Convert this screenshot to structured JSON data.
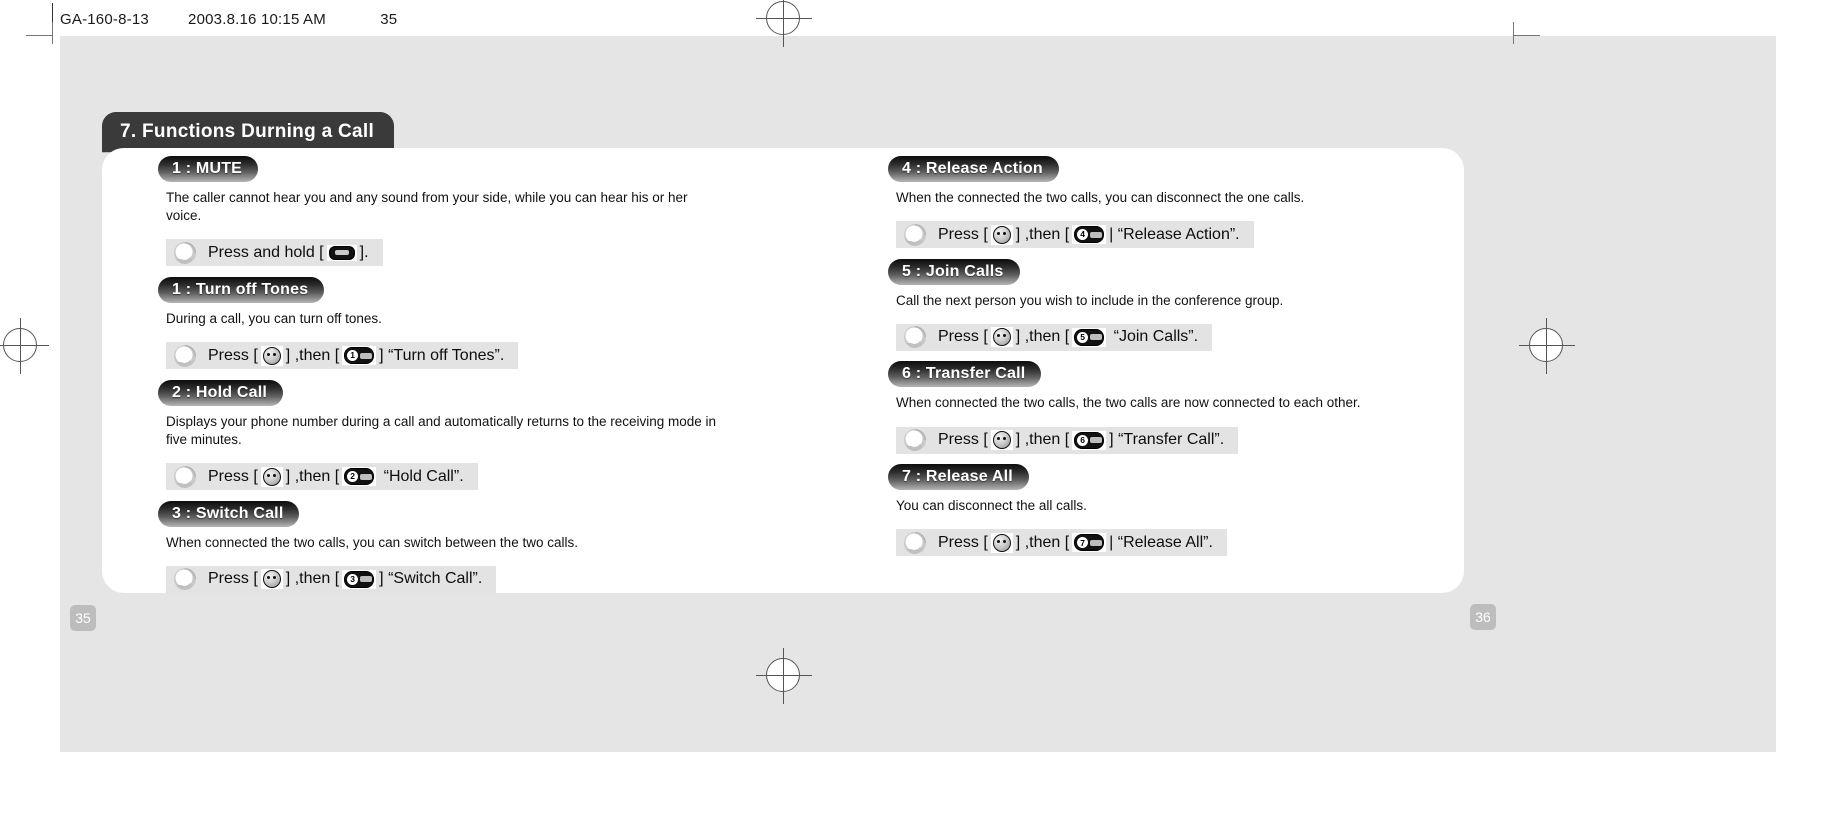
{
  "print_header": {
    "text": "GA-160-8-13　　  2003.8.16 10:15 AM 　　　 35"
  },
  "document": {
    "title": "7. Functions Durning a Call",
    "page_left": "35",
    "page_right": "36"
  },
  "icons": {
    "swirl": "swirl-bullet-icon",
    "menu_key": "menu-key-icon",
    "phone_key": "phone-key-icon"
  },
  "colors": {
    "title_bar": "#3a3a3a",
    "pill_dark": "#0d0d0d",
    "pill_light": "#b5b5b5",
    "instruction_band": "#e3e3e3",
    "page_number_bg": "#bdbdbd",
    "paper": "#e5e5e5"
  },
  "columns": {
    "left": [
      {
        "pill": "1 : MUTE",
        "desc": "The caller cannot hear you and any sound from your side, while you can hear his or her voice.",
        "instruction": {
          "prefix": "Press and hold [",
          "key1_type": "wide",
          "key1_label": "",
          "middle": "",
          "key2_type": "none",
          "key2_label": "",
          "suffix": "]."
        }
      },
      {
        "pill": "1 : Turn off Tones",
        "desc": "During a call, you can turn off tones.",
        "instruction": {
          "prefix": "Press [",
          "key1_type": "round",
          "key1_label": "",
          "middle": "] ,then [",
          "key2_type": "num",
          "key2_label": "1",
          "suffix": "] “Turn off Tones”."
        }
      },
      {
        "pill": "2 : Hold Call",
        "desc": "Displays your phone number during a call and automatically returns to the receiving mode in five minutes.",
        "instruction": {
          "prefix": "Press [",
          "key1_type": "round",
          "key1_label": "",
          "middle": "] ,then [",
          "key2_type": "num",
          "key2_label": "2",
          "suffix": " “Hold Call”."
        }
      },
      {
        "pill": "3 : Switch Call",
        "desc": "When connected the two calls, you can switch between the two calls.",
        "instruction": {
          "prefix": "Press [",
          "key1_type": "round",
          "key1_label": "",
          "middle": "] ,then [",
          "key2_type": "num",
          "key2_label": "3",
          "suffix": "] “Switch Call”."
        }
      }
    ],
    "right": [
      {
        "pill": "4 : Release Action",
        "desc": "When the connected the two calls, you can disconnect the one calls.",
        "instruction": {
          "prefix": "Press [",
          "key1_type": "round",
          "key1_label": "",
          "middle": "] ,then [",
          "key2_type": "num",
          "key2_label": "4",
          "suffix": "| “Release Action”."
        }
      },
      {
        "pill": "5 : Join Calls",
        "desc": "Call the next person you wish to include in the conference group.",
        "instruction": {
          "prefix": "Press [",
          "key1_type": "round",
          "key1_label": "",
          "middle": "] ,then [",
          "key2_type": "num",
          "key2_label": "5",
          "suffix": " “Join Calls”."
        }
      },
      {
        "pill": "6 : Transfer Call",
        "desc": "When connected the two calls, the two calls are now connected to each other.",
        "instruction": {
          "prefix": "Press [",
          "key1_type": "round",
          "key1_label": "",
          "middle": "] ,then [",
          "key2_type": "num",
          "key2_label": "6",
          "suffix": "] “Transfer Call”."
        }
      },
      {
        "pill": "7 : Release All",
        "desc": "You can disconnect the all calls.",
        "instruction": {
          "prefix": "Press [",
          "key1_type": "round",
          "key1_label": "",
          "middle": "] ,then [",
          "key2_type": "num",
          "key2_label": "7",
          "suffix": "| “Release All”."
        }
      }
    ]
  }
}
